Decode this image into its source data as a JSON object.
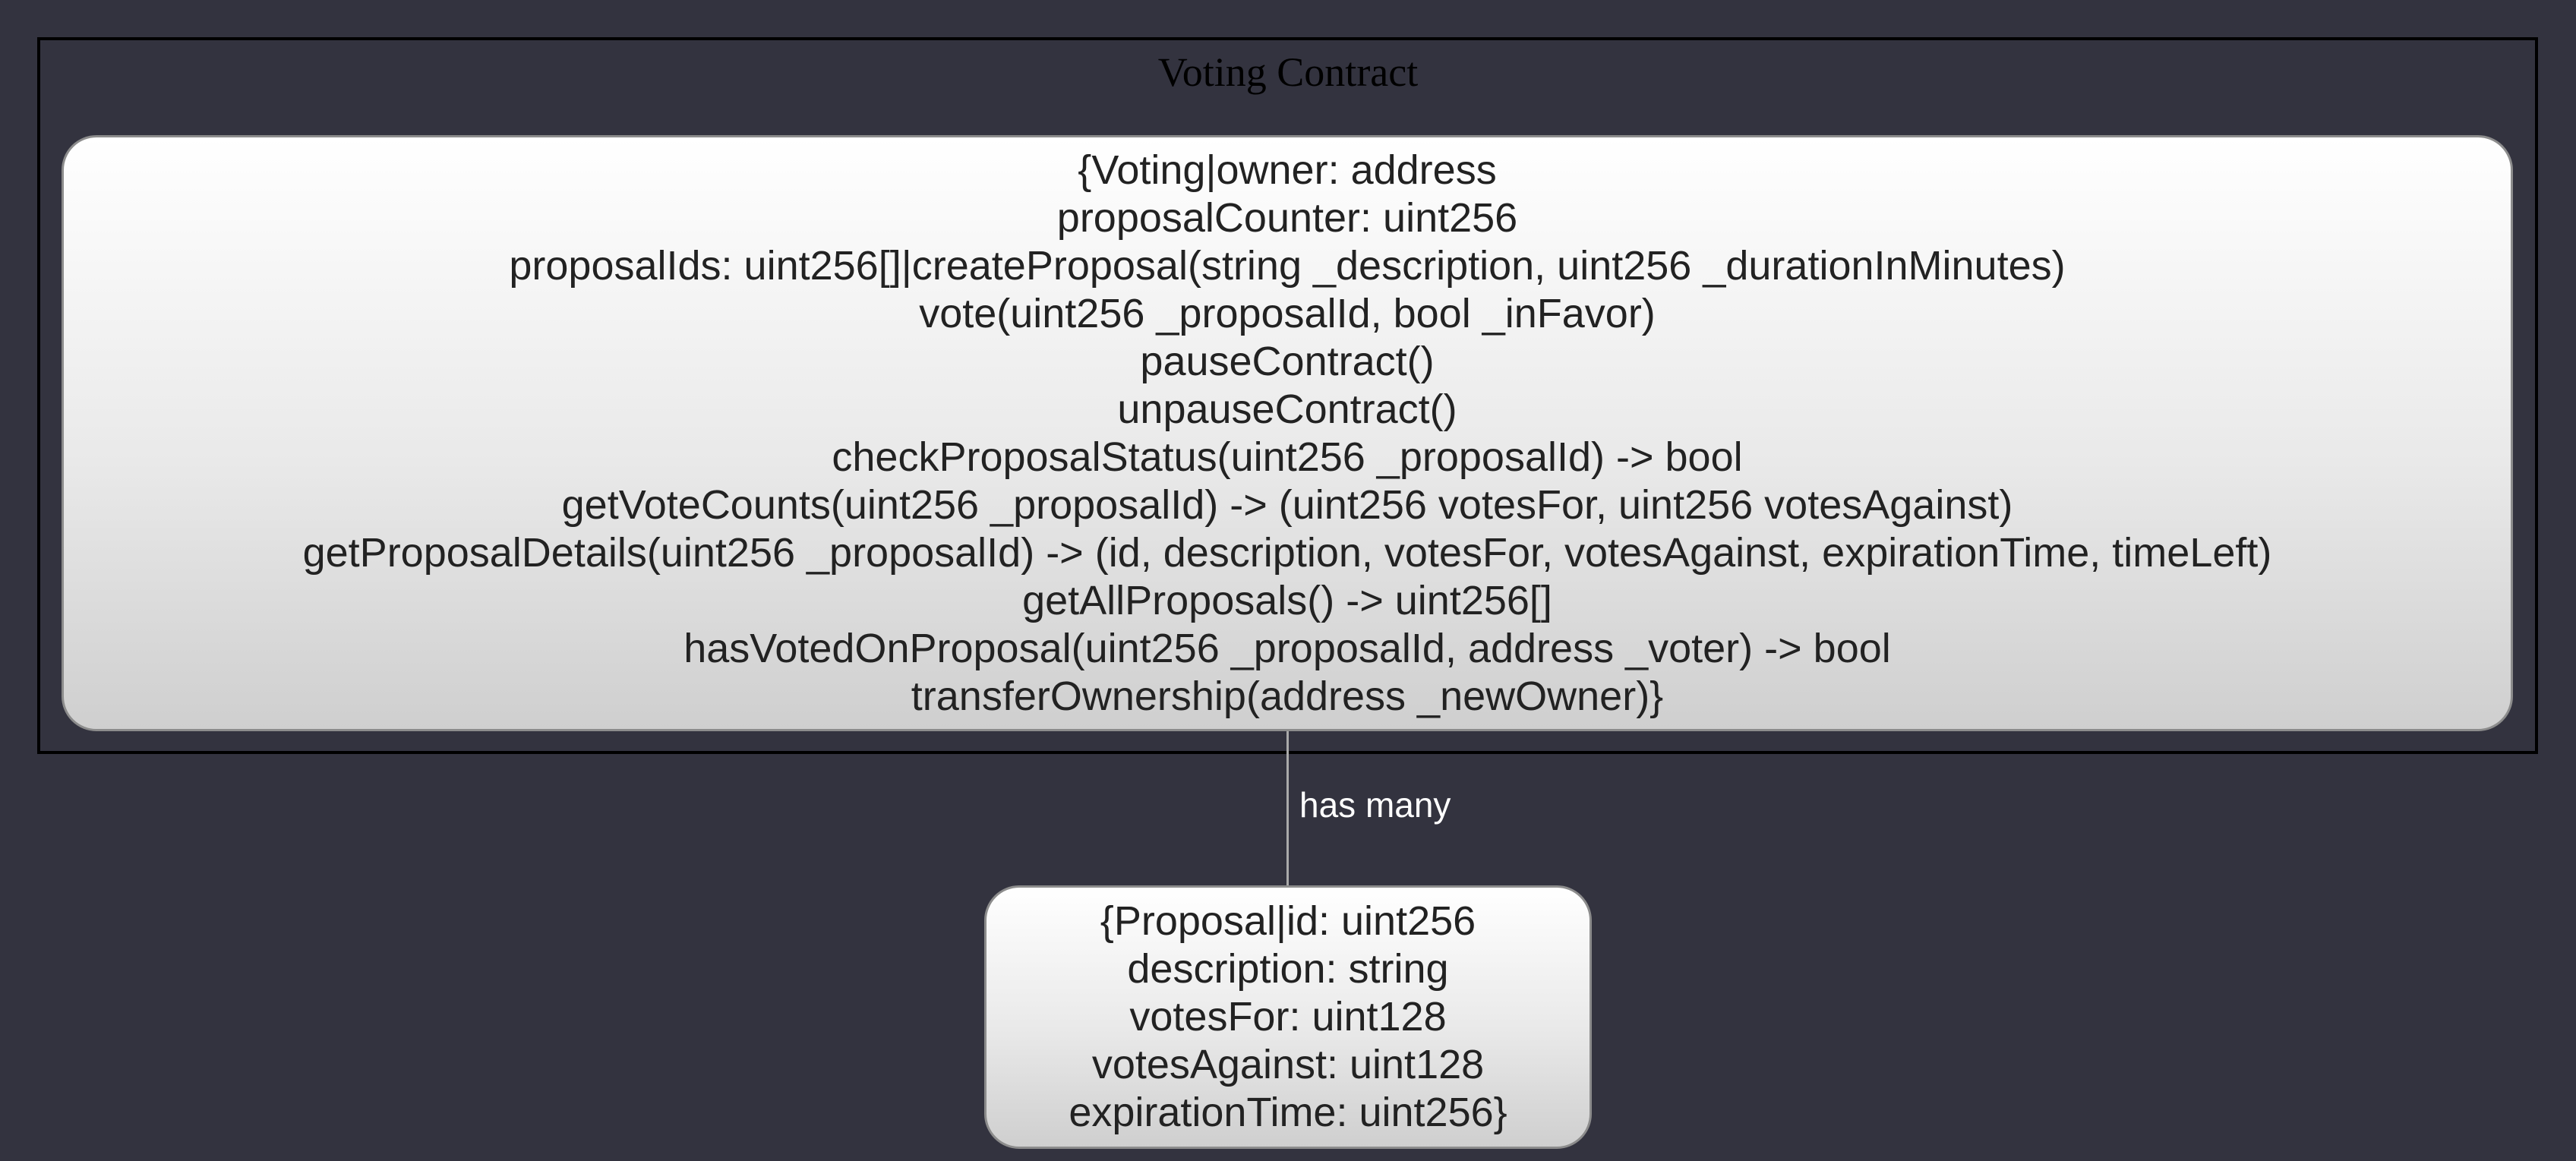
{
  "cluster": {
    "title": "Voting Contract"
  },
  "voting_node": {
    "lines": [
      "{Voting|owner: address",
      "proposalCounter: uint256",
      "proposalIds: uint256[]|createProposal(string _description, uint256 _durationInMinutes)",
      "vote(uint256 _proposalId, bool _inFavor)",
      "pauseContract()",
      "unpauseContract()",
      "checkProposalStatus(uint256 _proposalId) -> bool",
      "getVoteCounts(uint256 _proposalId) -> (uint256 votesFor, uint256 votesAgainst)",
      "getProposalDetails(uint256 _proposalId) -> (id, description, votesFor, votesAgainst, expirationTime, timeLeft)",
      "getAllProposals() -> uint256[]",
      "hasVotedOnProposal(uint256 _proposalId, address _voter) -> bool",
      "transferOwnership(address _newOwner)}"
    ]
  },
  "edge": {
    "label": "has many"
  },
  "proposal_node": {
    "lines": [
      "{Proposal|id: uint256",
      "description: string",
      "votesFor: uint128",
      "votesAgainst: uint128",
      "expirationTime: uint256}"
    ]
  },
  "colors": {
    "background": "#33333f",
    "cluster_border": "#000000",
    "node_border": "#8c8c8c",
    "node_fill_top": "#ffffff",
    "node_fill_bottom": "#cfcfcf",
    "edge": "#aaaaaa",
    "edge_label": "#ffffff"
  }
}
